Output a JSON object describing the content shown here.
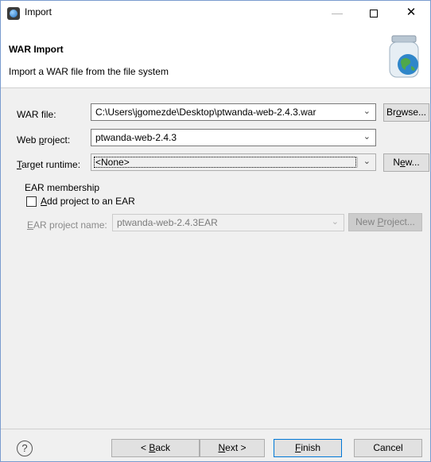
{
  "window": {
    "title": "Import",
    "minimize_glyph": "—",
    "close_glyph": "✕"
  },
  "banner": {
    "title": "WAR Import",
    "description": "Import a WAR file from the file system",
    "icon": "jar-globe-icon"
  },
  "form": {
    "war_file": {
      "label": "WAR file:",
      "value": "C:\\Users\\jgomezde\\Desktop\\ptwanda-web-2.4.3.war",
      "browse_label_pre": "Br",
      "browse_label_u": "o",
      "browse_label_post": "wse..."
    },
    "web_project": {
      "label_pre": "Web ",
      "label_u": "p",
      "label_post": "roject:",
      "value": "ptwanda-web-2.4.3"
    },
    "target_runtime": {
      "label_u": "T",
      "label_post": "arget runtime:",
      "value": "<None>",
      "new_label_pre": "N",
      "new_label_u": "e",
      "new_label_post": "w..."
    },
    "ear_membership": {
      "group_title": "EAR membership",
      "add_to_ear_u": "A",
      "add_to_ear_post": "dd project to an EAR",
      "add_to_ear_checked": false,
      "ear_name_u": "E",
      "ear_name_post": "AR project name:",
      "ear_name_value": "ptwanda-web-2.4.3EAR",
      "new_project_pre": "New ",
      "new_project_u": "P",
      "new_project_post": "roject..."
    }
  },
  "footer": {
    "help_glyph": "?",
    "back_pre": "< ",
    "back_u": "B",
    "back_post": "ack",
    "next_u": "N",
    "next_post": "ext >",
    "finish_u": "F",
    "finish_post": "inish",
    "cancel": "Cancel"
  },
  "colors": {
    "accent": "#0078d7",
    "window_border": "#7a9ccf"
  }
}
